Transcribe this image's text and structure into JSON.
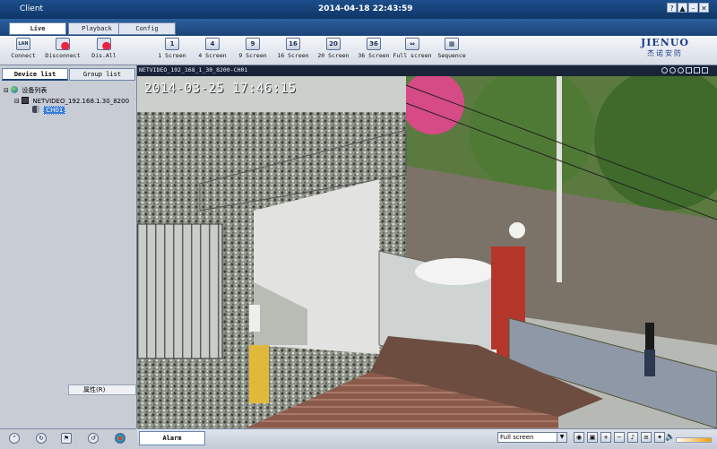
{
  "window": {
    "title": "Client",
    "datetime": "2014-04-18 22:43:59",
    "controls": [
      "?",
      "▲",
      "–",
      "✕"
    ]
  },
  "tabs": [
    {
      "label": "Live",
      "active": true
    },
    {
      "label": "Playback",
      "active": false
    },
    {
      "label": "Config",
      "active": false
    }
  ],
  "toolbar": {
    "buttons": [
      {
        "label": "Connect",
        "icon": "LAN"
      },
      {
        "label": "Disconnect",
        "icon": ""
      },
      {
        "label": "Dis.All",
        "icon": ""
      },
      {
        "label": "1 Screen",
        "icon": "1"
      },
      {
        "label": "4 Screen",
        "icon": "4"
      },
      {
        "label": "9 Screen",
        "icon": "9"
      },
      {
        "label": "16 Screen",
        "icon": "16"
      },
      {
        "label": "20 Screen",
        "icon": "20"
      },
      {
        "label": "36 Screen",
        "icon": "36"
      },
      {
        "label": "Full screen",
        "icon": "⇔"
      },
      {
        "label": "Sequence",
        "icon": "▦"
      }
    ],
    "logo_text": "JIENUO",
    "logo_sub": "杰诺安防"
  },
  "left_panel": {
    "tabs": [
      {
        "label": "Device list",
        "active": true
      },
      {
        "label": "Group list",
        "active": false
      }
    ],
    "tree": [
      {
        "label": "设备列表",
        "depth": 0,
        "toggle": "⊟"
      },
      {
        "label": "NETVIDEO_192.168.1.30_8200",
        "depth": 1,
        "toggle": "⊟"
      },
      {
        "label": "CH01",
        "depth": 2,
        "toggle": "",
        "selected": true
      }
    ],
    "context_menu": "属性(R)"
  },
  "video": {
    "header_title": "NETVIDEO_192_168_1_30_8200-CH01",
    "osd_timestamp": "2014-03-25 17:46:15"
  },
  "bottom": {
    "alarm_tab": "Alarm",
    "view_mode": "Full screen",
    "volume_level": 0.7
  },
  "colors": {
    "title_bar": "#1d4f8c",
    "selection": "#3a7bd5",
    "accent": "#1b4478"
  }
}
